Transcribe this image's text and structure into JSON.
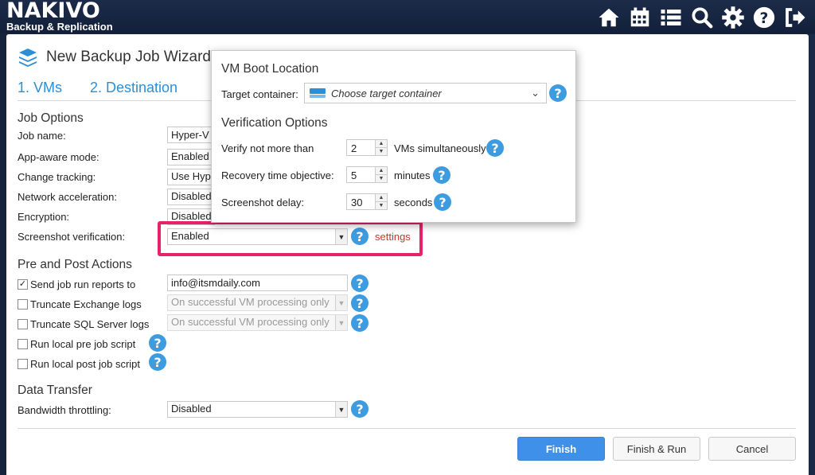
{
  "app": {
    "logo_line1": "NAKIVO",
    "logo_line2": "Backup & Replication"
  },
  "topbar_icons": [
    "home-icon",
    "calendar-icon",
    "list-icon",
    "search-icon",
    "gear-icon",
    "help-icon",
    "logout-icon"
  ],
  "wizard": {
    "title": "New Backup Job Wizard f",
    "steps": [
      "1. VMs",
      "2. Destination"
    ]
  },
  "job_options": {
    "heading": "Job Options",
    "rows": [
      {
        "label": "Job name:",
        "value": "Hyper-V"
      },
      {
        "label": "App-aware mode:",
        "value": "Enabled"
      },
      {
        "label": "Change tracking:",
        "value": "Use Hype"
      },
      {
        "label": "Network acceleration:",
        "value": "Disabled"
      },
      {
        "label": "Encryption:",
        "value": "Disabled"
      },
      {
        "label": "Screenshot verification:",
        "value": "Enabled"
      }
    ],
    "settings_link": "settings"
  },
  "pre_post": {
    "heading": "Pre and Post Actions",
    "items": [
      {
        "label": "Send job run reports to",
        "checked": true,
        "value": "info@itsmdaily.com"
      },
      {
        "label": "Truncate Exchange logs",
        "checked": false,
        "value": "On successful VM processing only"
      },
      {
        "label": "Truncate SQL Server logs",
        "checked": false,
        "value": "On successful VM processing only"
      },
      {
        "label": "Run local pre job script",
        "checked": false
      },
      {
        "label": "Run local post job script",
        "checked": false
      }
    ]
  },
  "data_transfer": {
    "heading": "Data Transfer",
    "label": "Bandwidth throttling:",
    "value": "Disabled"
  },
  "buttons": {
    "finish": "Finish",
    "finish_run": "Finish & Run",
    "cancel": "Cancel"
  },
  "popup": {
    "boot_heading": "VM Boot Location",
    "target_label": "Target container:",
    "target_placeholder": "Choose target container",
    "verif_heading": "Verification Options",
    "verify_label": "Verify not more than",
    "verify_value": "2",
    "verify_unit": "VMs simultaneously",
    "rto_label": "Recovery time objective:",
    "rto_value": "5",
    "rto_unit": "minutes",
    "delay_label": "Screenshot delay:",
    "delay_value": "30",
    "delay_unit": "seconds"
  },
  "colors": {
    "accent": "#3f90e8",
    "step_link": "#2c8fd6",
    "highlight": "#e8226a",
    "settings_link": "#c0392b",
    "help_icon": "#3d9be0"
  }
}
